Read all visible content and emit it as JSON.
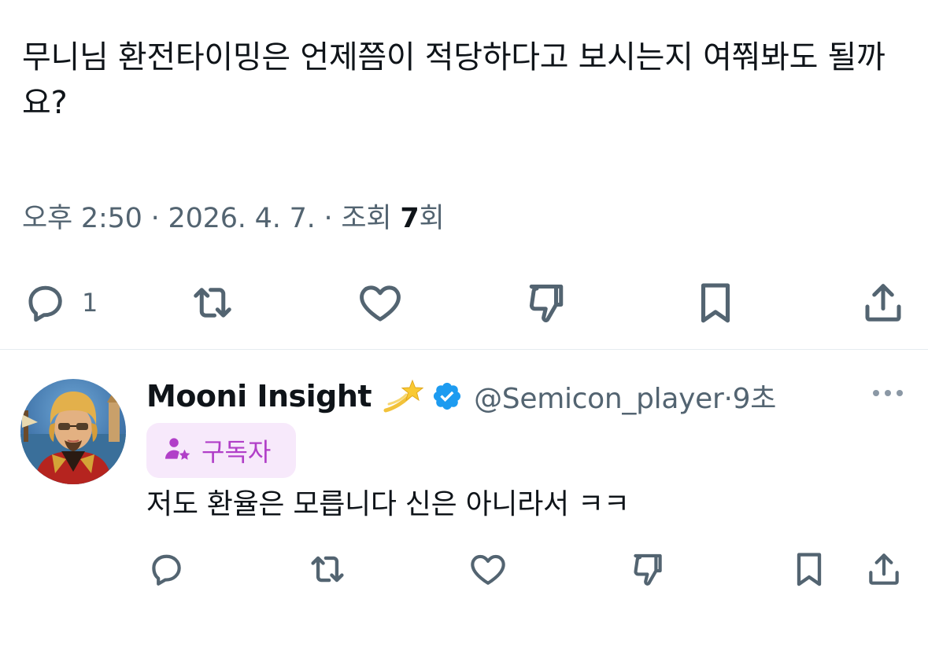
{
  "tweet": {
    "text": "무니님 환전타이밍은 언제쯤이 적당하다고 보시는지 여쭤봐도 될까요?",
    "time": "오후 2:50",
    "date": "2026. 4. 7.",
    "views_label": "조회",
    "views_count": "7",
    "views_unit": "회",
    "separator": "·",
    "reply_count": "1"
  },
  "reply": {
    "display_name": "Mooni Insight",
    "handle": "@Semicon_player",
    "time": "9초",
    "separator": "·",
    "badge_label": "구독자",
    "text": "저도 환율은 모릅니다 신은 아니라서 ㅋㅋ"
  },
  "colors": {
    "text_primary": "#0f1419",
    "text_secondary": "#536471",
    "verified_blue": "#1d9bf0",
    "badge_bg": "#f7e9fb",
    "badge_fg": "#b13fc8"
  },
  "icons": {
    "reply": "reply-icon",
    "repost": "repost-icon",
    "like": "heart-icon",
    "downvote": "thumbs-down-icon",
    "bookmark": "bookmark-icon",
    "share": "share-icon",
    "emoji": "dizzy-star-emoji",
    "verified": "verified-badge-icon",
    "subscriber": "subscriber-icon",
    "more": "more-icon"
  }
}
